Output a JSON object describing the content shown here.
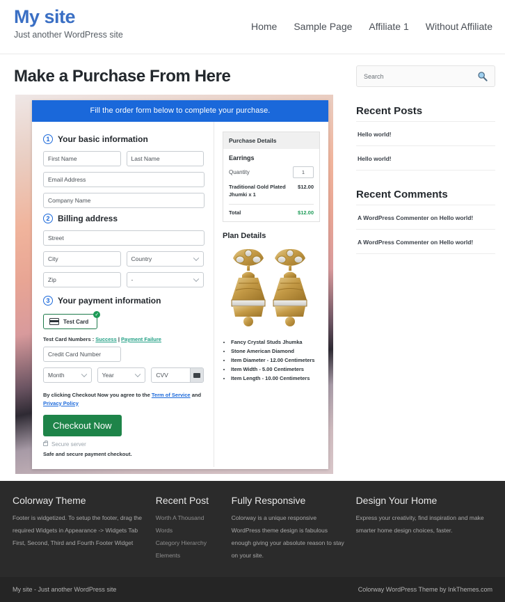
{
  "header": {
    "site_title": "My site",
    "tagline": "Just another WordPress site",
    "nav": [
      {
        "label": "Home"
      },
      {
        "label": "Sample Page"
      },
      {
        "label": "Affiliate 1"
      },
      {
        "label": "Without Affiliate"
      }
    ]
  },
  "main": {
    "page_title": "Make a Purchase From Here",
    "form_banner": "Fill the order form below to complete your purchase.",
    "steps": {
      "step1_num": "1",
      "step1_label": "Your basic information",
      "step2_num": "2",
      "step2_label": "Billing address",
      "step3_num": "3",
      "step3_label": "Your payment information"
    },
    "fields": {
      "first_name": "First Name",
      "last_name": "Last Name",
      "email": "Email Address",
      "company": "Company Name",
      "street": "Street",
      "city": "City",
      "country": "Country",
      "zip": "Zip",
      "state": "-",
      "card_number": "Credit Card Number",
      "month": "Month",
      "year": "Year",
      "cvv": "CVV"
    },
    "payment": {
      "test_card_label": "Test  Card",
      "test_card_check": "✓",
      "test_numbers_prefix": "Test Card Numbers : ",
      "test_numbers_success": "Success",
      "test_numbers_sep": " | ",
      "test_numbers_failure": "Payment Failure",
      "terms_prefix": "By clicking Checkout Now you agree to the ",
      "terms_tos": "Term of Service",
      "terms_and": " and ",
      "terms_privacy": "Privacy Policy",
      "checkout_label": "Checkout Now",
      "secure_server": "Secure server",
      "safe_note": "Safe and secure payment checkout."
    },
    "purchase_details": {
      "header": "Purchase Details",
      "item_name": "Earrings",
      "quantity_label": "Quantity",
      "quantity_value": "1",
      "line_item_name": "Traditional Gold Plated Jhumki x 1",
      "line_item_price": "$12.00",
      "total_label": "Total",
      "total_value": "$12.00"
    },
    "plan_details": {
      "title": "Plan Details",
      "features": [
        "Fancy Crystal Studs Jhumka",
        "Stone American Diamond",
        "Item Diameter - 12.00 Centimeters",
        "Item Width - 5.00 Centimeters",
        "Item Length - 10.00 Centimeters"
      ]
    }
  },
  "sidebar": {
    "search_placeholder": "Search",
    "recent_posts_title": "Recent Posts",
    "recent_posts": [
      {
        "label": "Hello world!"
      },
      {
        "label": "Hello world!"
      }
    ],
    "recent_comments_title": "Recent Comments",
    "recent_comments": [
      {
        "label": "A WordPress Commenter on Hello world!"
      },
      {
        "label": "A WordPress Commenter on Hello world!"
      }
    ]
  },
  "footer": {
    "col1_title": "Colorway Theme",
    "col1_text": "Footer is widgetized. To setup the footer, drag the required Widgets in Appearance -> Widgets Tab First, Second, Third and Fourth Footer Widget",
    "col2_title": "Recent Post",
    "col2_items": [
      {
        "label": "Worth A Thousand Words"
      },
      {
        "label": "Category Hierarchy"
      },
      {
        "label": "Elements"
      }
    ],
    "col3_title": "Fully Responsive",
    "col3_text": "Colorway is a unique responsive WordPress theme design is fabulous enough giving your absolute reason to stay on your site.",
    "col4_title": "Design Your Home",
    "col4_text": "Express your creativity, find inspiration and make smarter home design choices, faster.",
    "bottom_left": "My site - Just another WordPress site",
    "bottom_right": "Colorway WordPress Theme by InkThemes.com"
  },
  "colors": {
    "brand_blue": "#3a6fc4",
    "banner_blue": "#1a68da",
    "checkout_green": "#1e8449",
    "total_green": "#1d9b57",
    "footer_dark": "#2b2b2b"
  }
}
